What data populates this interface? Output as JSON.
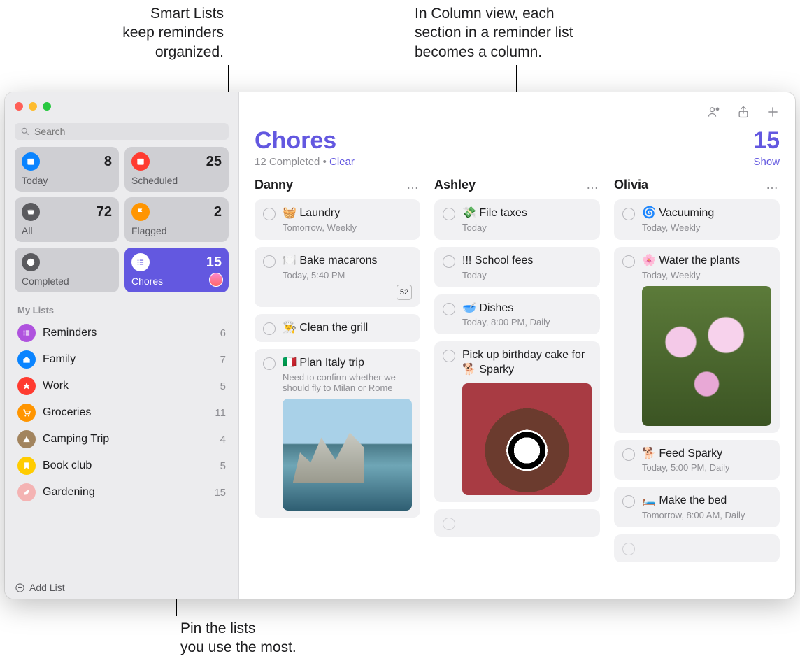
{
  "callouts": {
    "smart": "Smart Lists\nkeep reminders\norganized.",
    "columns": "In Column view, each\nsection in a reminder list\nbecomes a column.",
    "pin": "Pin the lists\nyou use the most."
  },
  "search": {
    "placeholder": "Search"
  },
  "smartLists": [
    {
      "id": "today",
      "label": "Today",
      "count": 8,
      "color": "c-blue",
      "icon": "calendar-icon"
    },
    {
      "id": "scheduled",
      "label": "Scheduled",
      "count": 25,
      "color": "c-red",
      "icon": "calendar-icon"
    },
    {
      "id": "all",
      "label": "All",
      "count": 72,
      "color": "c-grey",
      "icon": "tray-icon"
    },
    {
      "id": "flagged",
      "label": "Flagged",
      "count": 2,
      "color": "c-orange",
      "icon": "flag-icon"
    },
    {
      "id": "completed",
      "label": "Completed",
      "count": "",
      "color": "c-grey",
      "icon": "check-icon"
    },
    {
      "id": "chores",
      "label": "Chores",
      "count": 15,
      "color": "pinned",
      "icon": "list-icon",
      "pinned": true,
      "avatar": true
    }
  ],
  "myListsHeader": "My Lists",
  "myLists": [
    {
      "name": "Reminders",
      "count": 6,
      "color": "c-purple",
      "icon": "list-icon"
    },
    {
      "name": "Family",
      "count": 7,
      "color": "c-blue",
      "icon": "home-icon"
    },
    {
      "name": "Work",
      "count": 5,
      "color": "c-red",
      "icon": "star-icon"
    },
    {
      "name": "Groceries",
      "count": 11,
      "color": "c-orange",
      "icon": "cart-icon"
    },
    {
      "name": "Camping Trip",
      "count": 4,
      "color": "c-brown",
      "icon": "tent-icon"
    },
    {
      "name": "Book club",
      "count": 5,
      "color": "c-yellow",
      "icon": "bookmark-icon"
    },
    {
      "name": "Gardening",
      "count": 15,
      "color": "c-pink",
      "icon": "leaf-icon"
    }
  ],
  "addList": "Add List",
  "main": {
    "title": "Chores",
    "count": 15,
    "completedText": "12 Completed",
    "clear": "Clear",
    "show": "Show"
  },
  "columns": [
    {
      "name": "Danny",
      "items": [
        {
          "title": "🧺 Laundry",
          "sub": "Tomorrow, Weekly"
        },
        {
          "title": "🍽️ Bake macarons",
          "sub": "Today, 5:40 PM",
          "badge": "52"
        },
        {
          "title": "👨‍🍳 Clean the grill"
        },
        {
          "title": "🇮🇹 Plan Italy trip",
          "note": "Need to confirm whether we should fly to Milan or Rome",
          "image": "sea"
        }
      ]
    },
    {
      "name": "Ashley",
      "items": [
        {
          "title": "💸 File taxes",
          "sub": "Today"
        },
        {
          "title": "!!! School fees",
          "sub": "Today"
        },
        {
          "title": "🥣 Dishes",
          "sub": "Today, 8:00 PM, Daily"
        },
        {
          "title": "Pick up birthday cake for 🐕 Sparky",
          "image": "dog"
        },
        {
          "empty": true
        }
      ]
    },
    {
      "name": "Olivia",
      "items": [
        {
          "title": "🌀 Vacuuming",
          "sub": "Today, Weekly"
        },
        {
          "title": "🌸 Water the plants",
          "sub": "Today, Weekly",
          "image": "flowers"
        },
        {
          "title": "🐕 Feed Sparky",
          "sub": "Today, 5:00 PM, Daily"
        },
        {
          "title": "🛏️ Make the bed",
          "sub": "Tomorrow, 8:00 AM, Daily"
        },
        {
          "empty": true
        }
      ]
    }
  ]
}
